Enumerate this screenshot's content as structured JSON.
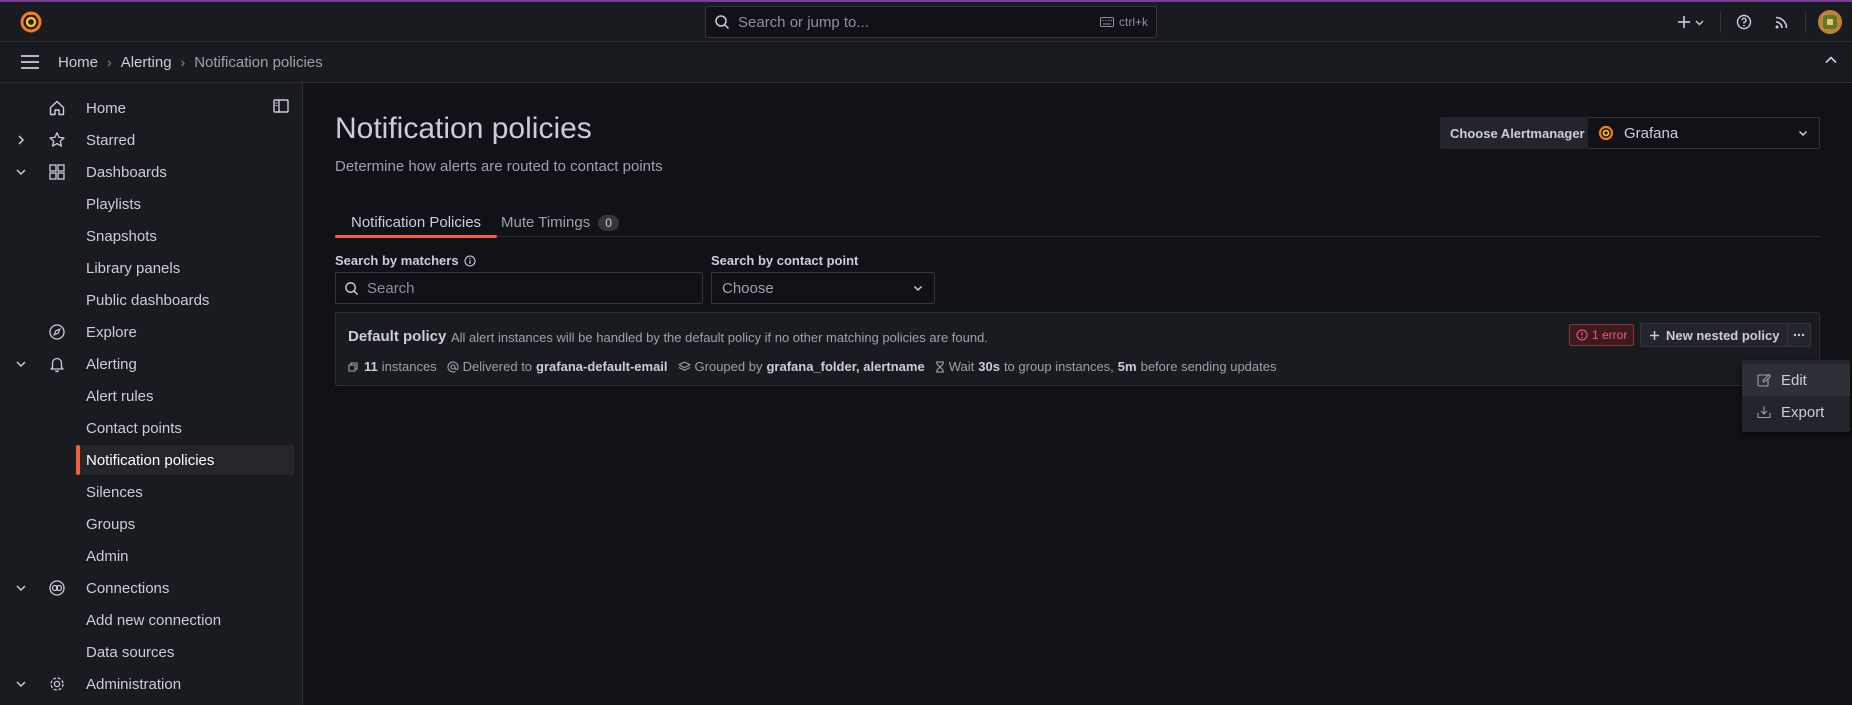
{
  "topbar": {
    "search_placeholder": "Search or jump to...",
    "search_shortcut": "ctrl+k"
  },
  "breadcrumb": {
    "items": [
      "Home",
      "Alerting",
      "Notification policies"
    ]
  },
  "sidebar": {
    "items": [
      {
        "label": "Home",
        "icon": "home-icon"
      },
      {
        "label": "Starred",
        "icon": "star-icon"
      },
      {
        "label": "Dashboards",
        "icon": "apps-icon"
      },
      {
        "label": "Playlists"
      },
      {
        "label": "Snapshots"
      },
      {
        "label": "Library panels"
      },
      {
        "label": "Public dashboards"
      },
      {
        "label": "Explore",
        "icon": "compass-icon"
      },
      {
        "label": "Alerting",
        "icon": "bell-icon"
      },
      {
        "label": "Alert rules"
      },
      {
        "label": "Contact points"
      },
      {
        "label": "Notification policies",
        "active": true
      },
      {
        "label": "Silences"
      },
      {
        "label": "Groups"
      },
      {
        "label": "Admin"
      },
      {
        "label": "Connections",
        "icon": "connections-icon"
      },
      {
        "label": "Add new connection"
      },
      {
        "label": "Data sources"
      },
      {
        "label": "Administration",
        "icon": "cog-icon"
      }
    ]
  },
  "page": {
    "title": "Notification policies",
    "subtitle": "Determine how alerts are routed to contact points",
    "alertmanager_label": "Choose Alertmanager",
    "alertmanager_value": "Grafana"
  },
  "tabs": [
    {
      "label": "Notification Policies",
      "active": true
    },
    {
      "label": "Mute Timings",
      "count": "0"
    }
  ],
  "filters": {
    "matchers_label": "Search by matchers",
    "matchers_placeholder": "Search",
    "contact_label": "Search by contact point",
    "contact_value": "Choose"
  },
  "policy": {
    "name": "Default policy",
    "description": "All alert instances will be handled by the default policy if no other matching policies are found.",
    "error_badge": "1 error",
    "new_nested_label": "New nested policy",
    "instances_count": "11",
    "instances_label": "instances",
    "delivered_label": "Delivered to",
    "delivered_value": "grafana-default-email",
    "grouped_label": "Grouped by",
    "grouped_value": "grafana_folder, alertname",
    "wait_label": "Wait",
    "wait_value": "30s",
    "wait_suffix": "to group instances,",
    "repeat_value": "5m",
    "repeat_suffix": "before sending updates"
  },
  "context_menu": {
    "items": [
      {
        "label": "Edit",
        "icon": "pen-icon"
      },
      {
        "label": "Export",
        "icon": "download-icon"
      }
    ]
  },
  "colors": {
    "accent": "#f55f3e",
    "background": "#111217",
    "panel": "#181b1f",
    "error": "#ff5286"
  }
}
